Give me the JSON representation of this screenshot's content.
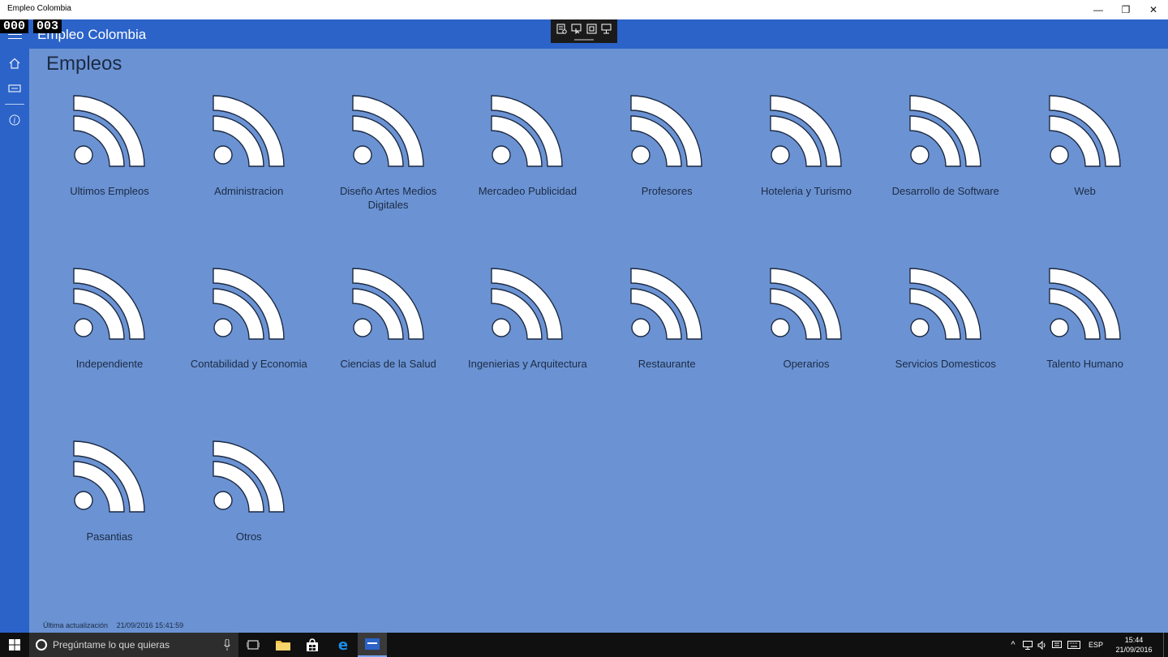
{
  "window": {
    "title": "Empleo Colombia",
    "controls": {
      "minimize": "—",
      "restore": "❐",
      "close": "✕"
    }
  },
  "frame_counter": [
    "000",
    "003"
  ],
  "appbar": {
    "title": "Empleo Colombia"
  },
  "page": {
    "title": "Empleos",
    "tile_icon": "rss-feed-icon",
    "tiles": [
      "Ultimos Empleos",
      "Administracion",
      "Diseño Artes Medios Digitales",
      "Mercadeo Publicidad",
      "Profesores",
      "Hoteleria y Turismo",
      "Desarrollo de Software",
      "Web",
      "Independiente",
      "Contabilidad y Economia",
      "Ciencias de la Salud",
      "Ingenierias y Arquitectura",
      "Restaurante",
      "Operarios",
      "Servicios Domesticos",
      "Talento Humano",
      "Pasantias",
      "Otros"
    ]
  },
  "status": {
    "label": "Última actualización",
    "value": "21/09/2016 15:41:59"
  },
  "taskbar": {
    "search_placeholder": "Pregúntame lo que quieras",
    "language": "ESP",
    "time": "15:44",
    "date": "21/09/2016"
  },
  "colors": {
    "accent": "#2b63c9",
    "background": "#6b93d3",
    "text": "#1c2a44"
  }
}
